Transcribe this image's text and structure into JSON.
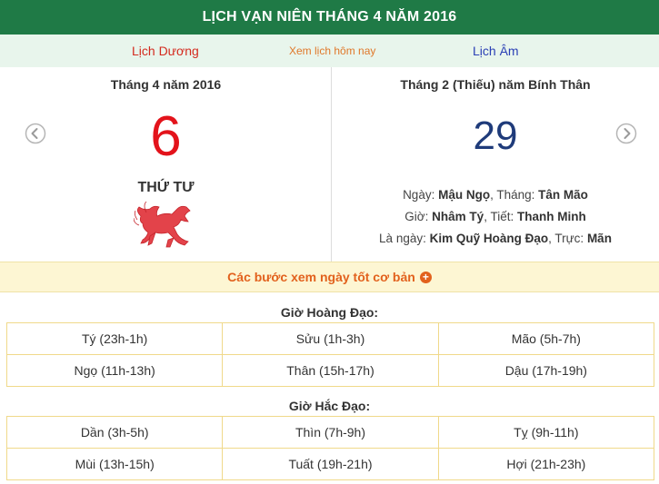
{
  "header": {
    "title": "LỊCH VẠN NIÊN THÁNG 4 NĂM 2016"
  },
  "nav": {
    "solar": "Lịch Dương",
    "today": "Xem lịch hôm nay",
    "lunar": "Lịch Âm"
  },
  "solar": {
    "month_year": "Tháng 4 năm 2016",
    "day": "6",
    "weekday": "THỨ TƯ",
    "zodiac_icon": "horse-zodiac-icon"
  },
  "lunar": {
    "month_year": "Tháng 2 (Thiếu) năm Bính Thân",
    "day": "29",
    "day_label": "Ngày:",
    "day_value": "Mậu Ngọ",
    "month_label": ", Tháng:",
    "month_value": "Tân Mão",
    "hour_label": "Giờ:",
    "hour_value": "Nhâm Tý",
    "term_label": ", Tiết:",
    "term_value": "Thanh Minh",
    "is_day_label": "Là ngày:",
    "is_day_value": "Kim Quỹ Hoàng Đạo",
    "truc_label": ", Trực:",
    "truc_value": "Mãn"
  },
  "steps": {
    "label": "Các bước xem ngày tốt cơ bản",
    "icon": "plus-circle-icon"
  },
  "auspicious": {
    "title": "Giờ Hoàng Đạo:",
    "hours": [
      "Tý (23h-1h)",
      "Sửu (1h-3h)",
      "Mão (5h-7h)",
      "Ngọ (11h-13h)",
      "Thân (15h-17h)",
      "Dậu (17h-19h)"
    ]
  },
  "inauspicious": {
    "title": "Giờ Hắc Đạo:",
    "hours": [
      "Dần (3h-5h)",
      "Thìn (7h-9h)",
      "Tỵ (9h-11h)",
      "Mùi (13h-15h)",
      "Tuất (19h-21h)",
      "Hợi (21h-23h)"
    ]
  },
  "colors": {
    "header_green": "#1f7a46",
    "solar_red": "#e3131b",
    "lunar_blue": "#1f3b7a",
    "steps_orange": "#e2611d"
  }
}
